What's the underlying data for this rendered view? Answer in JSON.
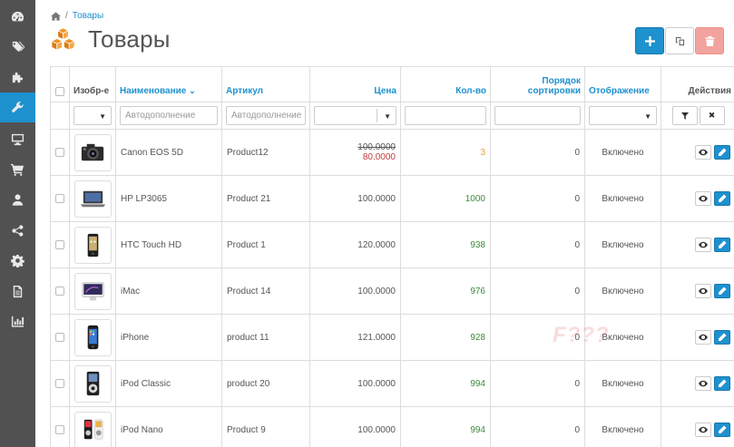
{
  "breadcrumb": {
    "current": "Товары"
  },
  "page": {
    "title": "Товары"
  },
  "table": {
    "headers": {
      "image": "Изобр-е",
      "name": "Наименование",
      "model": "Артикул",
      "price": "Цена",
      "quantity": "Кол-во",
      "sort_line1": "Порядок",
      "sort_line2": "сортировки",
      "status": "Отображение",
      "actions": "Действия"
    },
    "filters": {
      "name_placeholder": "Автодополнение",
      "model_placeholder": "Автодополнение"
    },
    "rows": [
      {
        "name": "Canon EOS 5D",
        "model": "Product12",
        "price": "100.0000",
        "special": "80.0000",
        "quantity": "3",
        "sort": "0",
        "status": "Включено",
        "image": "camera"
      },
      {
        "name": "HP LP3065",
        "model": "Product 21",
        "price": "100.0000",
        "quantity": "1000",
        "sort": "0",
        "status": "Включено",
        "image": "laptop"
      },
      {
        "name": "HTC Touch HD",
        "model": "Product 1",
        "price": "120.0000",
        "quantity": "938",
        "sort": "0",
        "status": "Включено",
        "image": "phone"
      },
      {
        "name": "iMac",
        "model": "Product 14",
        "price": "100.0000",
        "quantity": "976",
        "sort": "0",
        "status": "Включено",
        "image": "imac"
      },
      {
        "name": "iPhone",
        "model": "product 11",
        "price": "121.0000",
        "quantity": "928",
        "sort": "0",
        "status": "Включено",
        "image": "iphone"
      },
      {
        "name": "iPod Classic",
        "model": "product 20",
        "price": "100.0000",
        "quantity": "994",
        "sort": "0",
        "status": "Включено",
        "image": "ipod"
      },
      {
        "name": "iPod Nano",
        "model": "Product 9",
        "price": "100.0000",
        "quantity": "994",
        "sort": "0",
        "status": "Включено",
        "image": "ipodnano"
      }
    ]
  },
  "watermark": "F???",
  "colors": {
    "primary": "#1e91cf",
    "danger": "#f3a39e",
    "sidebar": "#515151",
    "stock_ok": "#3d8c3d",
    "stock_low": "#f0a030",
    "special": "#c43b3b"
  }
}
